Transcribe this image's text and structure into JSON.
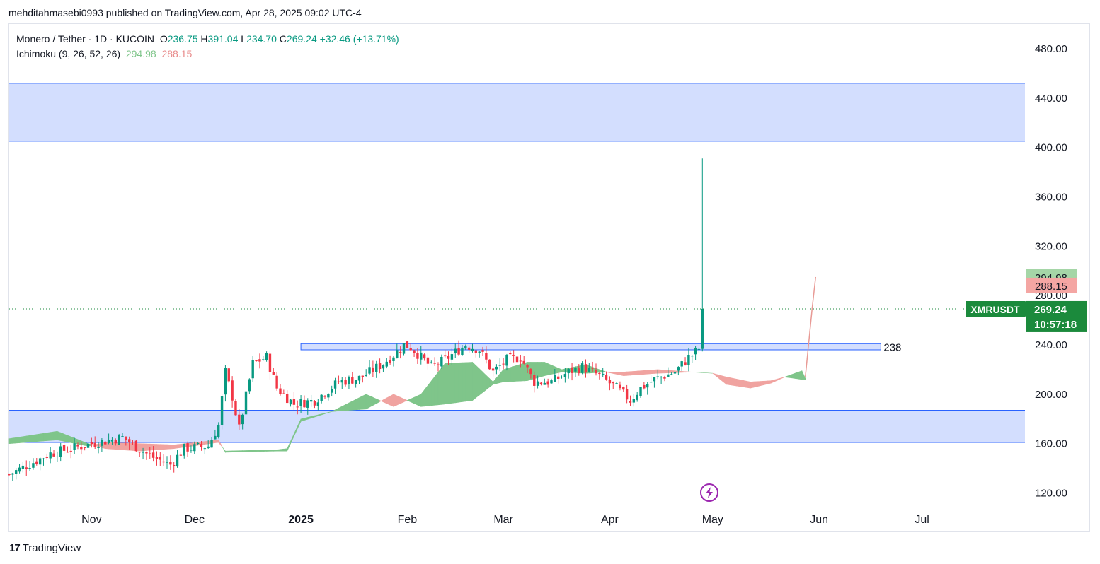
{
  "publisher_line": "mehditahmasebi0993 published on TradingView.com, Apr 28, 2025 09:02 UTC-4",
  "brand": {
    "logo_text": "17",
    "name": "TradingView"
  },
  "legend": {
    "symbol_line": "Monero / Tether · 1D · KUCOIN",
    "open_label": "O",
    "open": "236.75",
    "high_label": "H",
    "high": "391.04",
    "low_label": "L",
    "low": "234.70",
    "close_label": "C",
    "close": "269.24",
    "change": "+32.46 (+13.71%)",
    "indicator_name": "Ichimoku (9, 26, 52, 26)",
    "tenkan": "294.98",
    "kijun": "288.15"
  },
  "colors": {
    "up": "#089981",
    "down": "#f23645",
    "zone_fill": "#d3defe",
    "zone_line": "#2962ff",
    "cloud_bull": "#7fc58a",
    "cloud_bear": "#f0a3a0",
    "last_price_bg": "#1b8a3c"
  },
  "chart_data": {
    "type": "candlestick",
    "symbol": "XMRUSDT",
    "timeframe": "1D",
    "ylim": [
      110,
      500
    ],
    "y_ticks": [
      "120.00",
      "160.00",
      "200.00",
      "240.00",
      "280.00",
      "320.00",
      "360.00",
      "400.00",
      "440.00",
      "480.00"
    ],
    "x_ticks": [
      {
        "label": "Nov",
        "date": "2024-11-01",
        "bold": false
      },
      {
        "label": "Dec",
        "date": "2024-12-01",
        "bold": false
      },
      {
        "label": "2025",
        "date": "2025-01-01",
        "bold": true
      },
      {
        "label": "Feb",
        "date": "2025-02-01",
        "bold": false
      },
      {
        "label": "Mar",
        "date": "2025-03-01",
        "bold": false
      },
      {
        "label": "Apr",
        "date": "2025-04-01",
        "bold": false
      },
      {
        "label": "May",
        "date": "2025-05-01",
        "bold": false
      },
      {
        "label": "Jun",
        "date": "2025-06-01",
        "bold": false
      },
      {
        "label": "Jul",
        "date": "2025-07-01",
        "bold": false
      }
    ],
    "x_range": [
      "2024-10-08",
      "2025-07-31"
    ],
    "zones": [
      {
        "name": "upper-supply-zone",
        "from": 405,
        "to": 452
      },
      {
        "name": "lower-demand-zone",
        "from": 161,
        "to": 187
      },
      {
        "name": "breakout-zone",
        "from": 236,
        "to": 241,
        "start": "2025-01-01",
        "end": "2025-06-19",
        "label": "238"
      }
    ],
    "ohlc_anchors": [
      [
        "2024-10-08",
        135
      ],
      [
        "2024-10-20",
        152
      ],
      [
        "2024-11-01",
        160
      ],
      [
        "2024-11-10",
        165
      ],
      [
        "2024-11-18",
        150
      ],
      [
        "2024-11-24",
        143
      ],
      [
        "2024-11-28",
        156
      ],
      [
        "2024-12-05",
        158
      ],
      [
        "2024-12-08",
        175
      ],
      [
        "2024-12-10",
        218
      ],
      [
        "2024-12-12",
        198
      ],
      [
        "2024-12-14",
        172
      ],
      [
        "2024-12-18",
        225
      ],
      [
        "2024-12-22",
        230
      ],
      [
        "2024-12-25",
        205
      ],
      [
        "2024-12-30",
        192
      ],
      [
        "2025-01-05",
        195
      ],
      [
        "2025-01-12",
        210
      ],
      [
        "2025-01-18",
        213
      ],
      [
        "2025-01-25",
        225
      ],
      [
        "2025-01-28",
        232
      ],
      [
        "2025-01-31",
        240
      ],
      [
        "2025-02-02",
        238
      ],
      [
        "2025-02-05",
        230
      ],
      [
        "2025-02-08",
        222
      ],
      [
        "2025-02-12",
        228
      ],
      [
        "2025-02-18",
        240
      ],
      [
        "2025-02-22",
        236
      ],
      [
        "2025-02-26",
        218
      ],
      [
        "2025-03-02",
        228
      ],
      [
        "2025-03-06",
        230
      ],
      [
        "2025-03-10",
        210
      ],
      [
        "2025-03-15",
        210
      ],
      [
        "2025-03-20",
        218
      ],
      [
        "2025-03-24",
        222
      ],
      [
        "2025-03-29",
        215
      ],
      [
        "2025-04-03",
        205
      ],
      [
        "2025-04-07",
        195
      ],
      [
        "2025-04-10",
        205
      ],
      [
        "2025-04-14",
        212
      ],
      [
        "2025-04-20",
        218
      ],
      [
        "2025-04-24",
        230
      ],
      [
        "2025-04-26",
        234
      ],
      [
        "2025-04-27",
        237
      ]
    ],
    "last_candle": {
      "date": "2025-04-28",
      "open": 236.75,
      "high": 391.04,
      "low": 234.7,
      "close": 269.24
    },
    "kumo": [
      [
        "2024-10-08",
        164,
        160
      ],
      [
        "2024-10-22",
        170,
        163
      ],
      [
        "2024-10-31",
        160,
        158
      ],
      [
        "2024-11-05",
        156,
        161
      ],
      [
        "2024-11-15",
        154,
        160
      ],
      [
        "2024-11-25",
        156,
        159
      ],
      [
        "2024-12-08",
        161,
        163
      ],
      [
        "2024-12-10",
        154,
        153
      ],
      [
        "2024-12-25",
        155,
        154
      ],
      [
        "2024-12-28",
        156,
        154
      ],
      [
        "2025-01-01",
        180,
        178
      ],
      [
        "2025-01-10",
        186,
        186
      ],
      [
        "2025-01-20",
        200,
        188
      ],
      [
        "2025-01-28",
        190,
        200
      ],
      [
        "2025-02-05",
        200,
        190
      ],
      [
        "2025-02-12",
        225,
        192
      ],
      [
        "2025-02-20",
        226,
        195
      ],
      [
        "2025-02-26",
        210,
        208
      ],
      [
        "2025-03-01",
        220,
        210
      ],
      [
        "2025-03-08",
        226,
        211
      ],
      [
        "2025-03-13",
        226,
        215
      ],
      [
        "2025-03-18",
        220,
        218
      ],
      [
        "2025-03-25",
        224,
        217
      ],
      [
        "2025-03-31",
        218,
        218
      ],
      [
        "2025-04-05",
        215,
        218
      ],
      [
        "2025-04-15",
        217,
        220
      ],
      [
        "2025-04-25",
        218,
        218
      ],
      [
        "2025-05-01",
        217,
        217
      ],
      [
        "2025-05-05",
        208,
        214
      ],
      [
        "2025-05-12",
        205,
        210
      ],
      [
        "2025-05-18",
        209,
        211
      ],
      [
        "2025-05-22",
        214,
        214
      ],
      [
        "2025-05-27",
        219,
        212
      ],
      [
        "2025-05-28",
        213,
        212
      ]
    ],
    "kumo_spike": [
      [
        "2025-05-28",
        214
      ],
      [
        "2025-05-30",
        270
      ],
      [
        "2025-05-31",
        295
      ]
    ],
    "price_labels": [
      {
        "name": "tenkan-label",
        "text": "294.98",
        "value": 294.98,
        "color": "#a5d6a7",
        "text_color": "#131722"
      },
      {
        "name": "kijun-label",
        "text": "288.15",
        "value": 288.15,
        "color": "#f4a6a3",
        "text_color": "#131722"
      }
    ],
    "last_price": {
      "symbol": "XMRUSDT",
      "value": 269.24,
      "text": "269.24",
      "countdown": "10:57:18"
    },
    "event_marker_date": "2025-04-30"
  }
}
